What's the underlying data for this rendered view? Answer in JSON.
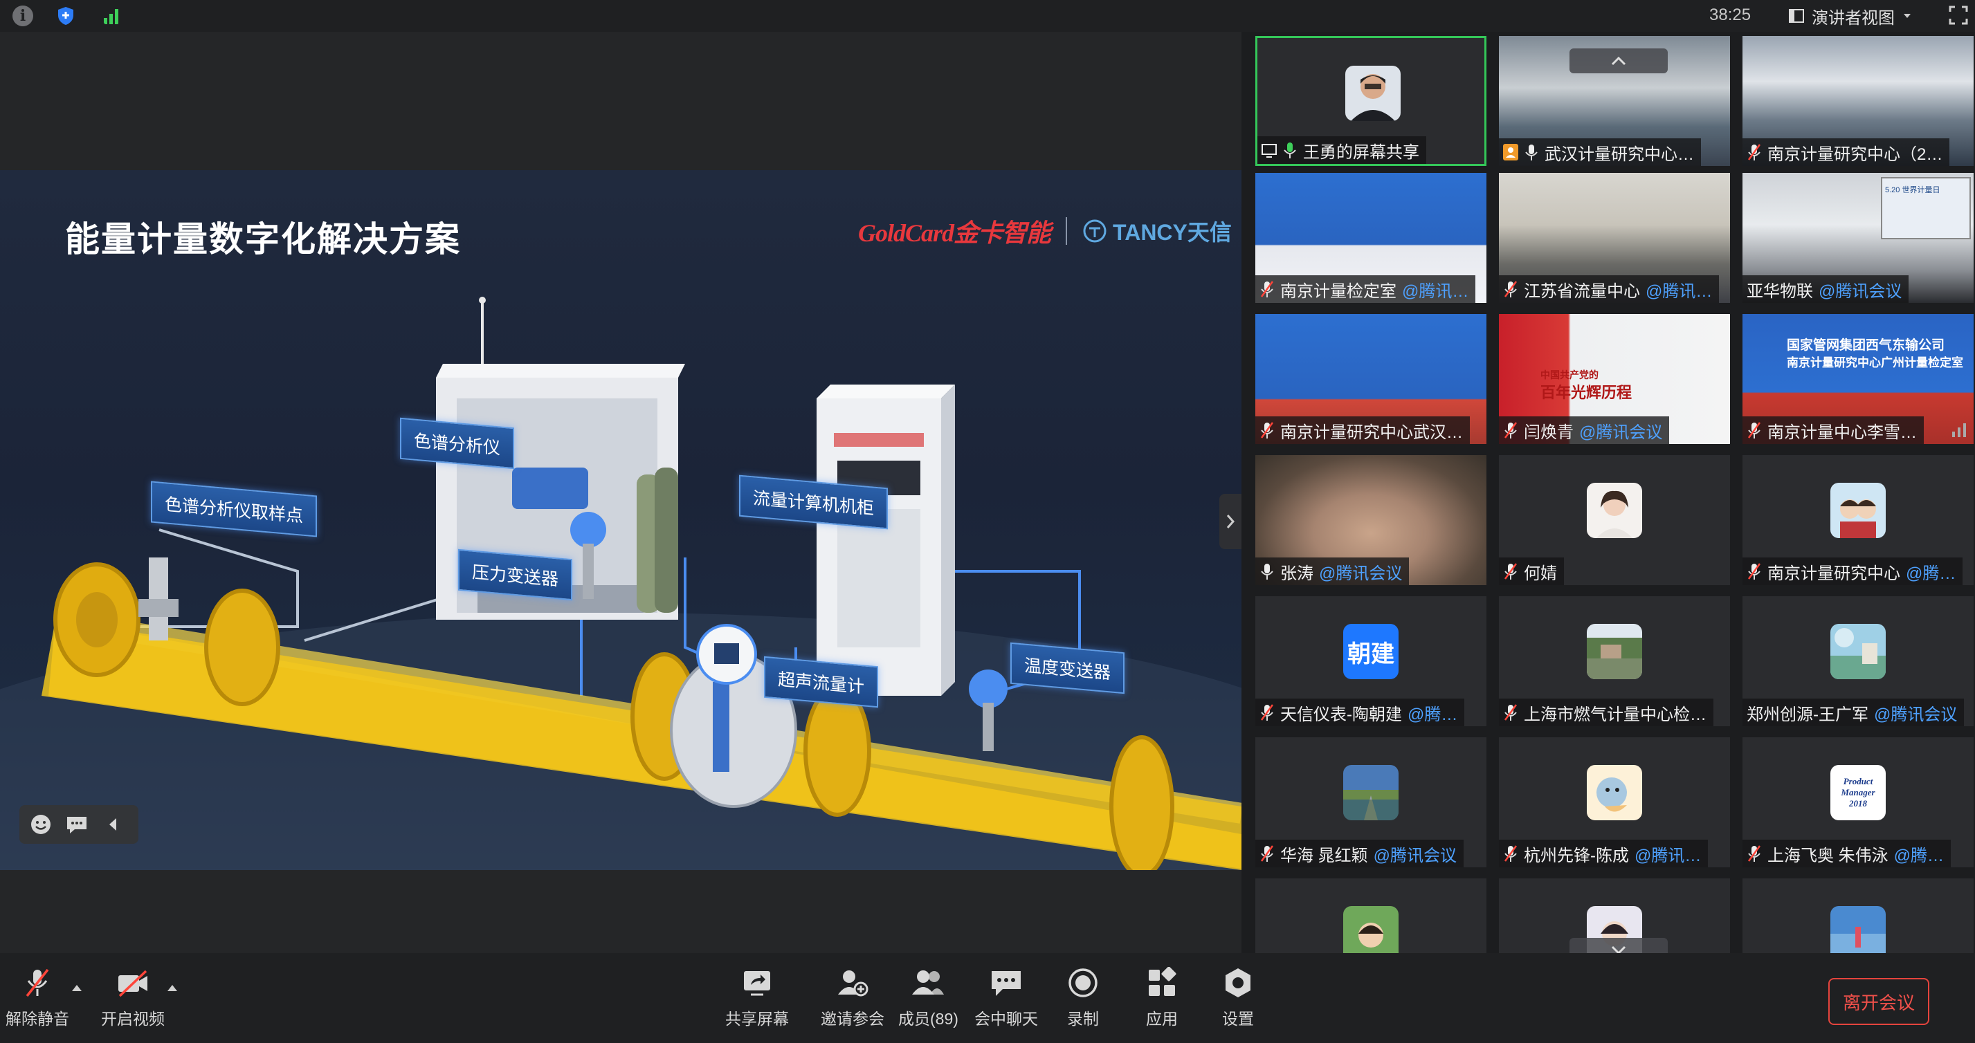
{
  "topbar": {
    "timer": "38:25",
    "view_mode_label": "演讲者视图",
    "icons": [
      "info-icon",
      "shield-icon",
      "signal-icon",
      "fullscreen-icon"
    ]
  },
  "slide": {
    "title": "能量计量数字化解决方案",
    "brand_goldcard": "GoldCard金卡智能",
    "brand_tancy": "TANCY天信",
    "callouts": {
      "sampling": "色谱分析仪取样点",
      "chromatograph": "色谱分析仪",
      "pressure": "压力变送器",
      "flow_cabinet": "流量计算机机柜",
      "ultrasonic": "超声流量计",
      "temperature": "温度变送器"
    },
    "colors": {
      "pipe": "#f0c41c",
      "callout": "#2a5fa8"
    }
  },
  "participants": [
    {
      "name": "王勇的屏幕共享",
      "tag": "",
      "mic": "on"
    },
    {
      "name": "武汉计量研究中心…",
      "tag": "",
      "mic": "on"
    },
    {
      "name": "南京计量研究中心（2…",
      "tag": "",
      "mic": "muted"
    },
    {
      "name": "南京计量检定室",
      "tag": "@腾讯…",
      "mic": "muted"
    },
    {
      "name": "江苏省流量中心",
      "tag": "@腾讯…",
      "mic": "muted"
    },
    {
      "name": "亚华物联",
      "tag": "@腾讯会议",
      "mic": "none"
    },
    {
      "name": "南京计量研究中心武汉…",
      "tag": "",
      "mic": "muted"
    },
    {
      "name": "闫焕青",
      "tag": "@腾讯会议",
      "mic": "muted"
    },
    {
      "name": "南京计量中心李雪…",
      "tag": "",
      "mic": "muted"
    },
    {
      "name": "张涛",
      "tag": "@腾讯会议",
      "mic": "on"
    },
    {
      "name": "何婧",
      "tag": "",
      "mic": "muted"
    },
    {
      "name": "南京计量研究中心",
      "tag": "@腾…",
      "mic": "muted"
    },
    {
      "name": "天信仪表-陶朝建",
      "tag": "@腾…",
      "mic": "muted",
      "avatar_text": "朝建"
    },
    {
      "name": "上海市燃气计量中心检…",
      "tag": "",
      "mic": "muted"
    },
    {
      "name": "郑州创源-王广军",
      "tag": "@腾讯会议",
      "mic": "none"
    },
    {
      "name": "华海 晁红颖",
      "tag": "@腾讯会议",
      "mic": "muted"
    },
    {
      "name": "杭州先锋-陈成",
      "tag": "@腾讯…",
      "mic": "muted"
    },
    {
      "name": "上海飞奥 朱伟泳",
      "tag": "@腾…",
      "mic": "muted"
    }
  ],
  "video_text": {
    "banner_line1": "国家管网集团西气东输公司",
    "banner_line2": "南京计量研究中心广州计量检定室",
    "slogan_line1": "中国共产党的",
    "slogan_line2": "百年光辉历程",
    "screen_text": "5.20 世界计量日",
    "avatar_caption_line1": "Product",
    "avatar_caption_line2": "Manager",
    "avatar_caption_line3": "2018"
  },
  "toolbar": {
    "unmute": "解除静音",
    "start_video": "开启视频",
    "share_screen": "共享屏幕",
    "invite": "邀请参会",
    "members": "成员(89)",
    "chat": "会中聊天",
    "record": "录制",
    "apps": "应用",
    "settings": "设置",
    "leave": "离开会议"
  }
}
